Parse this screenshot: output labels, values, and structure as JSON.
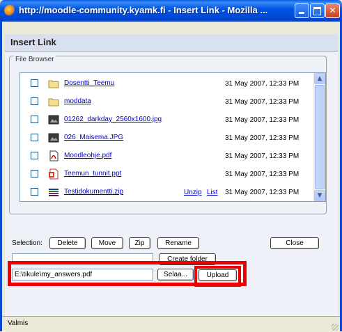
{
  "window": {
    "title": "http://moodle-community.kyamk.fi - Insert Link - Mozilla ...",
    "controls": [
      "minimize-icon",
      "maximize-icon",
      "close-icon"
    ],
    "close_glyph": "✕"
  },
  "panel": {
    "title": "Insert Link"
  },
  "file_browser": {
    "legend": "File Browser",
    "items": [
      {
        "name": "Dosentti_Teemu",
        "icon": "folder-icon",
        "date": "31 May 2007, 12:33 PM",
        "actions": []
      },
      {
        "name": "moddata",
        "icon": "folder-icon",
        "date": "31 May 2007, 12:33 PM",
        "actions": []
      },
      {
        "name": "01262_darkday_2560x1600.jpg",
        "icon": "image-file-icon",
        "date": "31 May 2007, 12:33 PM",
        "actions": []
      },
      {
        "name": "026_Maisema.JPG",
        "icon": "image-file-icon",
        "date": "31 May 2007, 12:33 PM",
        "actions": []
      },
      {
        "name": "Moodleohje.pdf",
        "icon": "pdf-file-icon",
        "date": "31 May 2007, 12:33 PM",
        "actions": []
      },
      {
        "name": "Teemun_tunnit.ppt",
        "icon": "ppt-file-icon",
        "date": "31 May 2007, 12:33 PM",
        "actions": []
      },
      {
        "name": "Testidokumentti.zip",
        "icon": "zip-file-icon",
        "date": "31 May 2007, 12:33 PM",
        "actions": [
          "Unzip",
          "List"
        ]
      }
    ],
    "scroll_up": "▲",
    "scroll_down": "▼"
  },
  "toolbar": {
    "selection_label": "Selection:",
    "delete": "Delete",
    "move": "Move",
    "zip": "Zip",
    "rename": "Rename",
    "close": "Close"
  },
  "folder": {
    "name_value": "",
    "create_label": "Create folder"
  },
  "upload": {
    "file_value": "E:\\tikule\\my_answers.pdf",
    "browse_label": "Selaa...",
    "upload_label": "Upload"
  },
  "status": {
    "text": "Valmis"
  },
  "colors": {
    "titlebar": "#0055e5",
    "highlight": "#ee0000",
    "link": "#0000cc",
    "panel_header": "#d9e0f0"
  }
}
